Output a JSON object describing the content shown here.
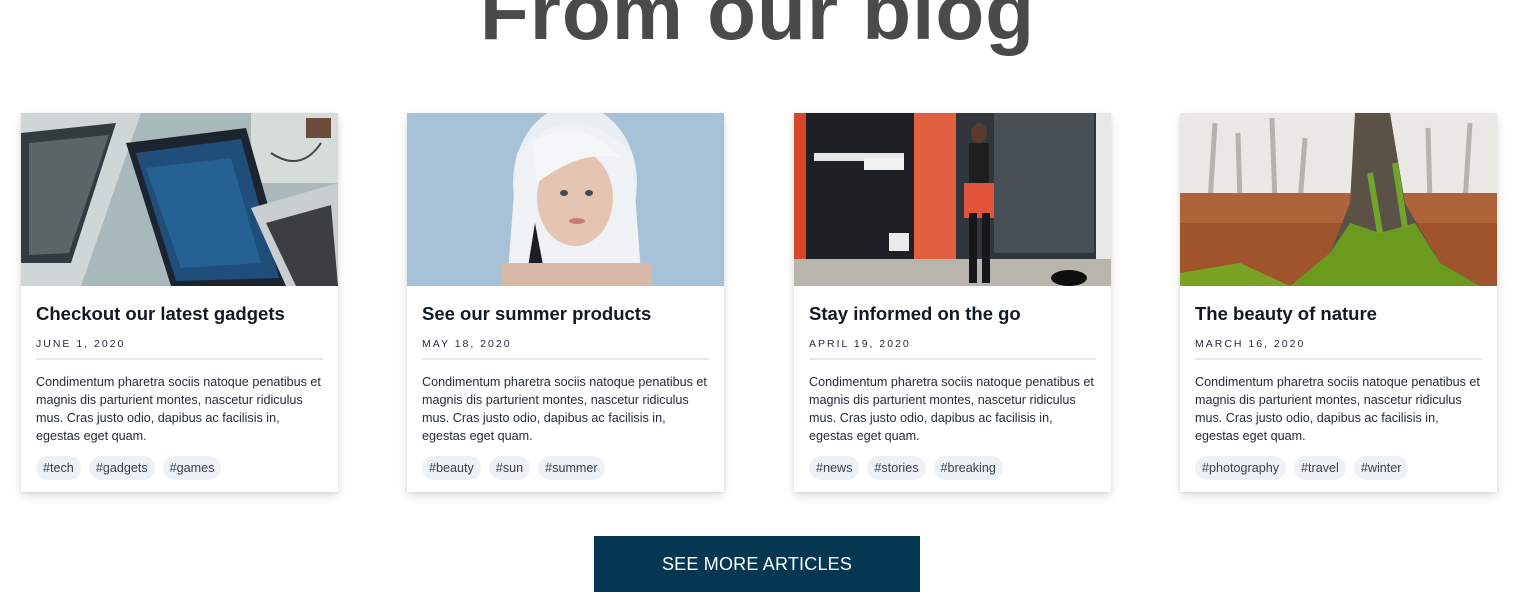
{
  "section": {
    "title": "From our blog"
  },
  "cards": [
    {
      "image": "laptop-photo",
      "title": "Checkout our latest gadgets",
      "date": "JUNE 1, 2020",
      "text": "Condimentum pharetra sociis natoque penatibus et magnis dis parturient montes, nascetur ridiculus mus. Cras justo odio, dapibus ac facilisis in, egestas eget quam.",
      "tags": [
        "#tech",
        "#gadgets",
        "#games"
      ]
    },
    {
      "image": "portrait-photo",
      "title": "See our summer products",
      "date": "MAY 18, 2020",
      "text": "Condimentum pharetra sociis natoque penatibus et magnis dis parturient montes, nascetur ridiculus mus. Cras justo odio, dapibus ac facilisis in, egestas eget quam.",
      "tags": [
        "#beauty",
        "#sun",
        "#summer"
      ]
    },
    {
      "image": "street-photo",
      "title": "Stay informed on the go",
      "date": "APRIL 19, 2020",
      "text": "Condimentum pharetra sociis natoque penatibus et magnis dis parturient montes, nascetur ridiculus mus. Cras justo odio, dapibus ac facilisis in, egestas eget quam.",
      "tags": [
        "#news",
        "#stories",
        "#breaking"
      ]
    },
    {
      "image": "forest-photo",
      "title": "The beauty of nature",
      "date": "MARCH 16, 2020",
      "text": "Condimentum pharetra sociis natoque penatibus et magnis dis parturient montes, nascetur ridiculus mus. Cras justo odio, dapibus ac facilisis in, egestas eget quam.",
      "tags": [
        "#photography",
        "#travel",
        "#winter"
      ]
    }
  ],
  "cta": {
    "label": "SEE MORE ARTICLES"
  },
  "colors": {
    "button": "#053753",
    "tag_bg": "#edf1f5",
    "title": "#4a4a4a"
  }
}
